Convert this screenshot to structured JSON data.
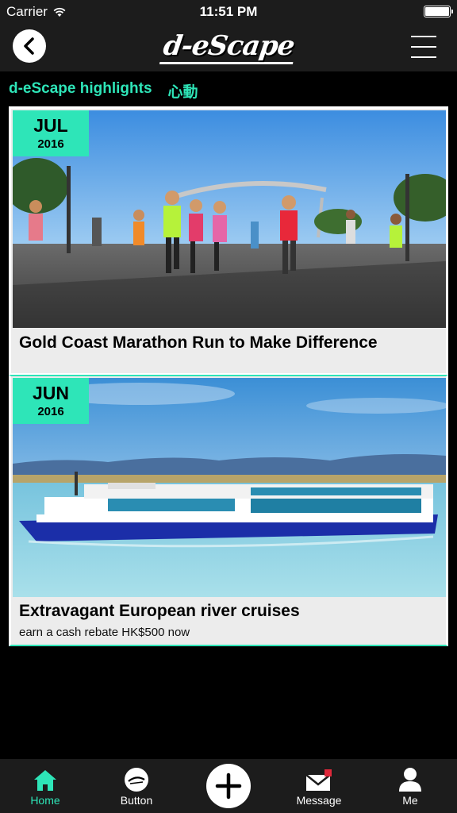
{
  "status_bar": {
    "carrier": "Carrier",
    "time": "11:51 PM"
  },
  "nav": {
    "logo": "d-eScape"
  },
  "section": {
    "title": "d-eScape highlights",
    "subtitle": "心動"
  },
  "cards": [
    {
      "month": "JUL",
      "year": "2016",
      "title": "Gold Coast Marathon Run to Make Difference",
      "subtitle": ""
    },
    {
      "month": "JUN",
      "year": "2016",
      "title": "Extravagant European river cruises",
      "subtitle": "earn a cash rebate HK$500 now"
    }
  ],
  "tabs": [
    {
      "label": "Home",
      "icon": "home-icon",
      "active": true
    },
    {
      "label": "Button",
      "icon": "escape-logo-icon"
    },
    {
      "label": "",
      "icon": "plus-icon"
    },
    {
      "label": "Message",
      "icon": "envelope-icon"
    },
    {
      "label": "Me",
      "icon": "person-icon"
    }
  ],
  "colors": {
    "accent": "#2ee5b8",
    "bar": "#1c1c1c",
    "background": "#000000"
  }
}
